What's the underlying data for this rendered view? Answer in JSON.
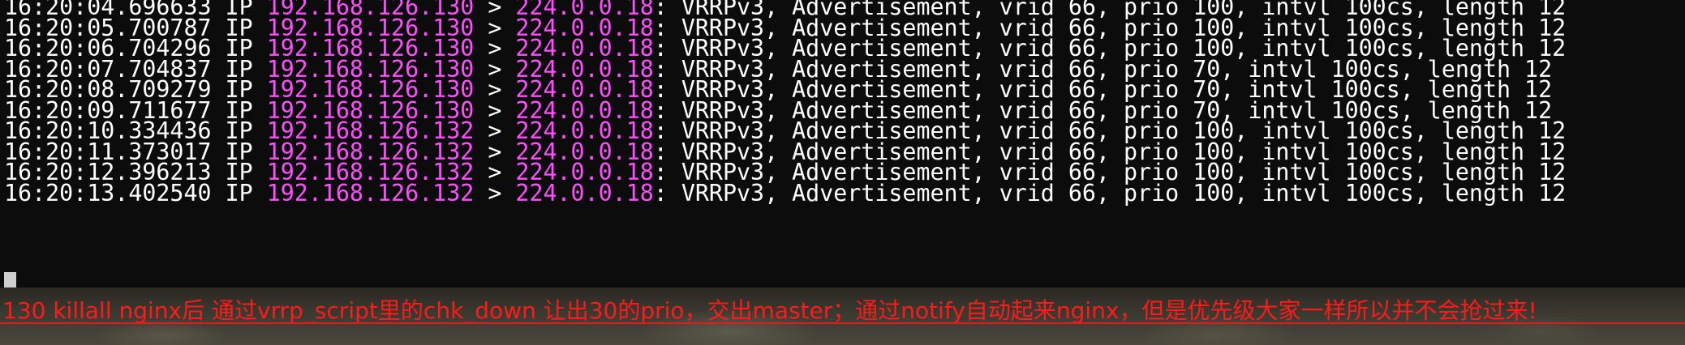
{
  "terminal": {
    "lines": [
      {
        "time": "16:20:04.696633",
        "proto": "IP",
        "src": "192.168.126.130",
        "arrow": ">",
        "dst": "224.0.0.18",
        "info": ": VRRPv3, Advertisement, vrid 66, prio 100, intvl 100cs, length 12"
      },
      {
        "time": "16:20:05.700787",
        "proto": "IP",
        "src": "192.168.126.130",
        "arrow": ">",
        "dst": "224.0.0.18",
        "info": ": VRRPv3, Advertisement, vrid 66, prio 100, intvl 100cs, length 12"
      },
      {
        "time": "16:20:06.704296",
        "proto": "IP",
        "src": "192.168.126.130",
        "arrow": ">",
        "dst": "224.0.0.18",
        "info": ": VRRPv3, Advertisement, vrid 66, prio 100, intvl 100cs, length 12"
      },
      {
        "time": "16:20:07.704837",
        "proto": "IP",
        "src": "192.168.126.130",
        "arrow": ">",
        "dst": "224.0.0.18",
        "info": ": VRRPv3, Advertisement, vrid 66, prio 70, intvl 100cs, length 12"
      },
      {
        "time": "16:20:08.709279",
        "proto": "IP",
        "src": "192.168.126.130",
        "arrow": ">",
        "dst": "224.0.0.18",
        "info": ": VRRPv3, Advertisement, vrid 66, prio 70, intvl 100cs, length 12"
      },
      {
        "time": "16:20:09.711677",
        "proto": "IP",
        "src": "192.168.126.130",
        "arrow": ">",
        "dst": "224.0.0.18",
        "info": ": VRRPv3, Advertisement, vrid 66, prio 70, intvl 100cs, length 12"
      },
      {
        "time": "16:20:10.334436",
        "proto": "IP",
        "src": "192.168.126.132",
        "arrow": ">",
        "dst": "224.0.0.18",
        "info": ": VRRPv3, Advertisement, vrid 66, prio 100, intvl 100cs, length 12"
      },
      {
        "time": "16:20:11.373017",
        "proto": "IP",
        "src": "192.168.126.132",
        "arrow": ">",
        "dst": "224.0.0.18",
        "info": ": VRRPv3, Advertisement, vrid 66, prio 100, intvl 100cs, length 12"
      },
      {
        "time": "16:20:12.396213",
        "proto": "IP",
        "src": "192.168.126.132",
        "arrow": ">",
        "dst": "224.0.0.18",
        "info": ": VRRPv3, Advertisement, vrid 66, prio 100, intvl 100cs, length 12"
      },
      {
        "time": "16:20:13.402540",
        "proto": "IP",
        "src": "192.168.126.132",
        "arrow": ">",
        "dst": "224.0.0.18",
        "info": ": VRRPv3, Advertisement, vrid 66, prio 100, intvl 100cs, length 12"
      }
    ]
  },
  "annotation": {
    "text": "130 killall nginx后 通过vrrp_script里的chk_down 让出30的prio，交出master；通过notify自动起来nginx，但是优先级大家一样所以并不会抢过来!"
  },
  "colors": {
    "background": "#0c0c0c",
    "text": "#ffffff",
    "ip_highlight": "#ff4dff",
    "annotation": "#ff1a1a"
  }
}
